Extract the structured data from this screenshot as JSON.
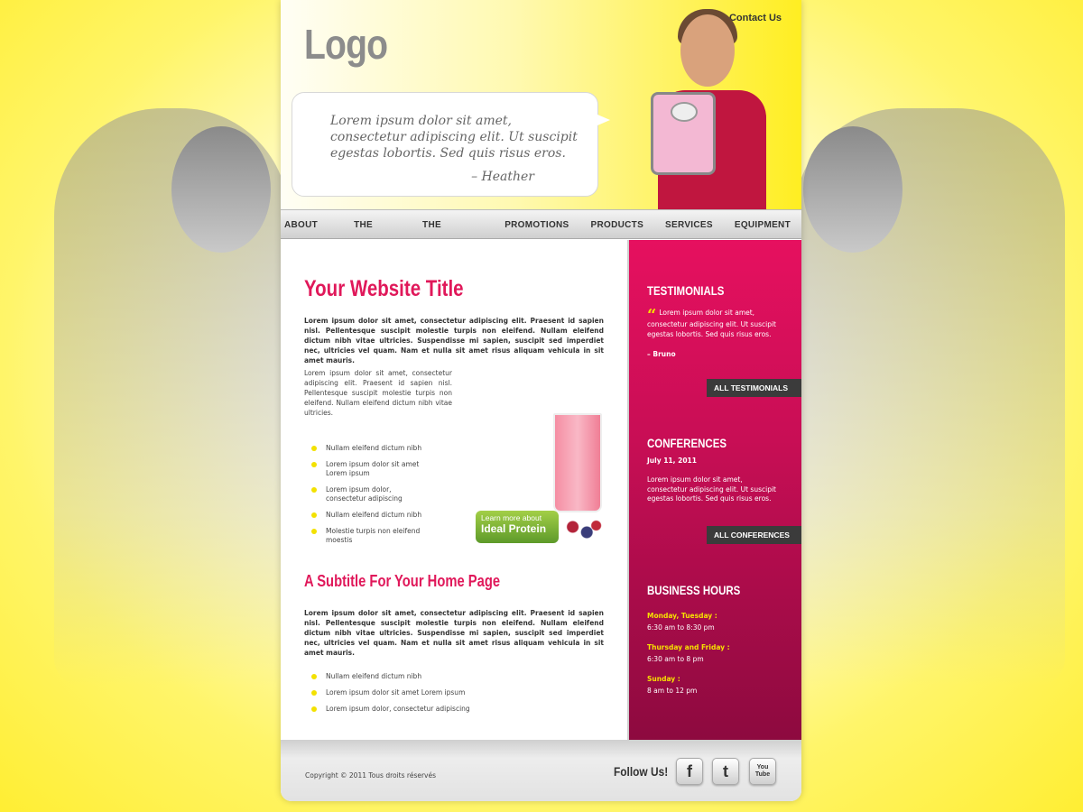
{
  "header": {
    "logo": "Logo",
    "contact_label": "Contact Us",
    "quote": "Lorem ipsum dolor sit amet, consectetur adipiscing elit. Ut suscipit egestas lobortis. Sed quis risus eros.",
    "quote_author": "– Heather"
  },
  "nav": {
    "items": [
      {
        "label": "ABOUT US"
      },
      {
        "label": "THE TEAM"
      },
      {
        "label": "THE METHOD"
      },
      {
        "label": "PROMOTIONS"
      },
      {
        "label": "PRODUCTS"
      },
      {
        "label": "SERVICES"
      },
      {
        "label": "EQUIPMENT"
      }
    ]
  },
  "main": {
    "title": "Your Website Title",
    "intro": "Lorem ipsum dolor sit amet, consectetur adipiscing elit. Praesent id sapien nisl. Pellentesque suscipit molestie turpis non eleifend. Nullam eleifend dictum nibh vitae ultricies. Suspendisse mi sapien, suscipit sed imperdiet nec, ultricies vel quam. Nam et nulla sit amet risus aliquam vehicula in sit amet mauris.",
    "body": "Lorem ipsum dolor sit amet, consectetur adipiscing elit. Praesent id sapien nisl. Pellentesque suscipit molestie turpis non eleifend. Nullam eleifend dictum nibh vitae ultricies.",
    "list1": [
      "Nullam eleifend dictum nibh",
      "Lorem ipsum dolor sit amet Lorem ipsum",
      "Lorem ipsum dolor, consectetur adipiscing",
      "Nullam eleifend dictum nibh",
      "Molestie turpis non eleifend moestis"
    ],
    "protein_line1": "Learn more about",
    "protein_line2": "Ideal Protein",
    "subtitle": "A Subtitle For Your Home Page",
    "intro2": "Lorem ipsum dolor sit amet, consectetur adipiscing elit. Praesent id sapien nisl. Pellentesque suscipit molestie turpis non eleifend. Nullam eleifend dictum nibh vitae ultricies. Suspendisse mi sapien, suscipit sed imperdiet nec, ultricies vel quam. Nam et nulla sit amet risus aliquam vehicula in sit amet mauris.",
    "list2": [
      "Nullam eleifend dictum nibh",
      "Lorem ipsum dolor sit amet Lorem ipsum",
      "Lorem ipsum dolor, consectetur adipiscing"
    ]
  },
  "sidebar": {
    "testimonials_title": "TESTIMONIALS",
    "testimonial_text": "Lorem ipsum dolor sit amet, consectetur adipiscing elit. Ut suscipit egestas lobortis. Sed quis risus eros.",
    "testimonial_author": "– Bruno",
    "all_testimonials": "ALL TESTIMONIALS",
    "conferences_title": "CONFERENCES",
    "conference_date": "July 11, 2011",
    "conference_text": "Lorem ipsum dolor sit amet, consectetur adipiscing elit. Ut suscipit egestas lobortis. Sed quis risus eros.",
    "all_conferences": "ALL CONFERENCES",
    "hours_title": "BUSINESS HOURS",
    "hours": [
      {
        "day": "Monday, Tuesday :",
        "time": "6:30 am to 8:30 pm"
      },
      {
        "day": "Thursday and Friday :",
        "time": "6:30 am to 8 pm"
      },
      {
        "day": "Sunday :",
        "time": "8 am to 12 pm"
      }
    ]
  },
  "footer": {
    "copyright": "Copyright © 2011 Tous droits réservés",
    "follow_label": "Follow Us!",
    "facebook": "f",
    "twitter": "t",
    "youtube_1": "You",
    "youtube_2": "Tube"
  },
  "colors": {
    "accent": "#e0185a",
    "sidebar_top": "#e6105f",
    "sidebar_bottom": "#8d0a3f",
    "bullet": "#f3e100",
    "background": "#fff56a"
  },
  "icons": [
    "facebook-icon",
    "twitter-icon",
    "youtube-icon",
    "quote-icon"
  ]
}
